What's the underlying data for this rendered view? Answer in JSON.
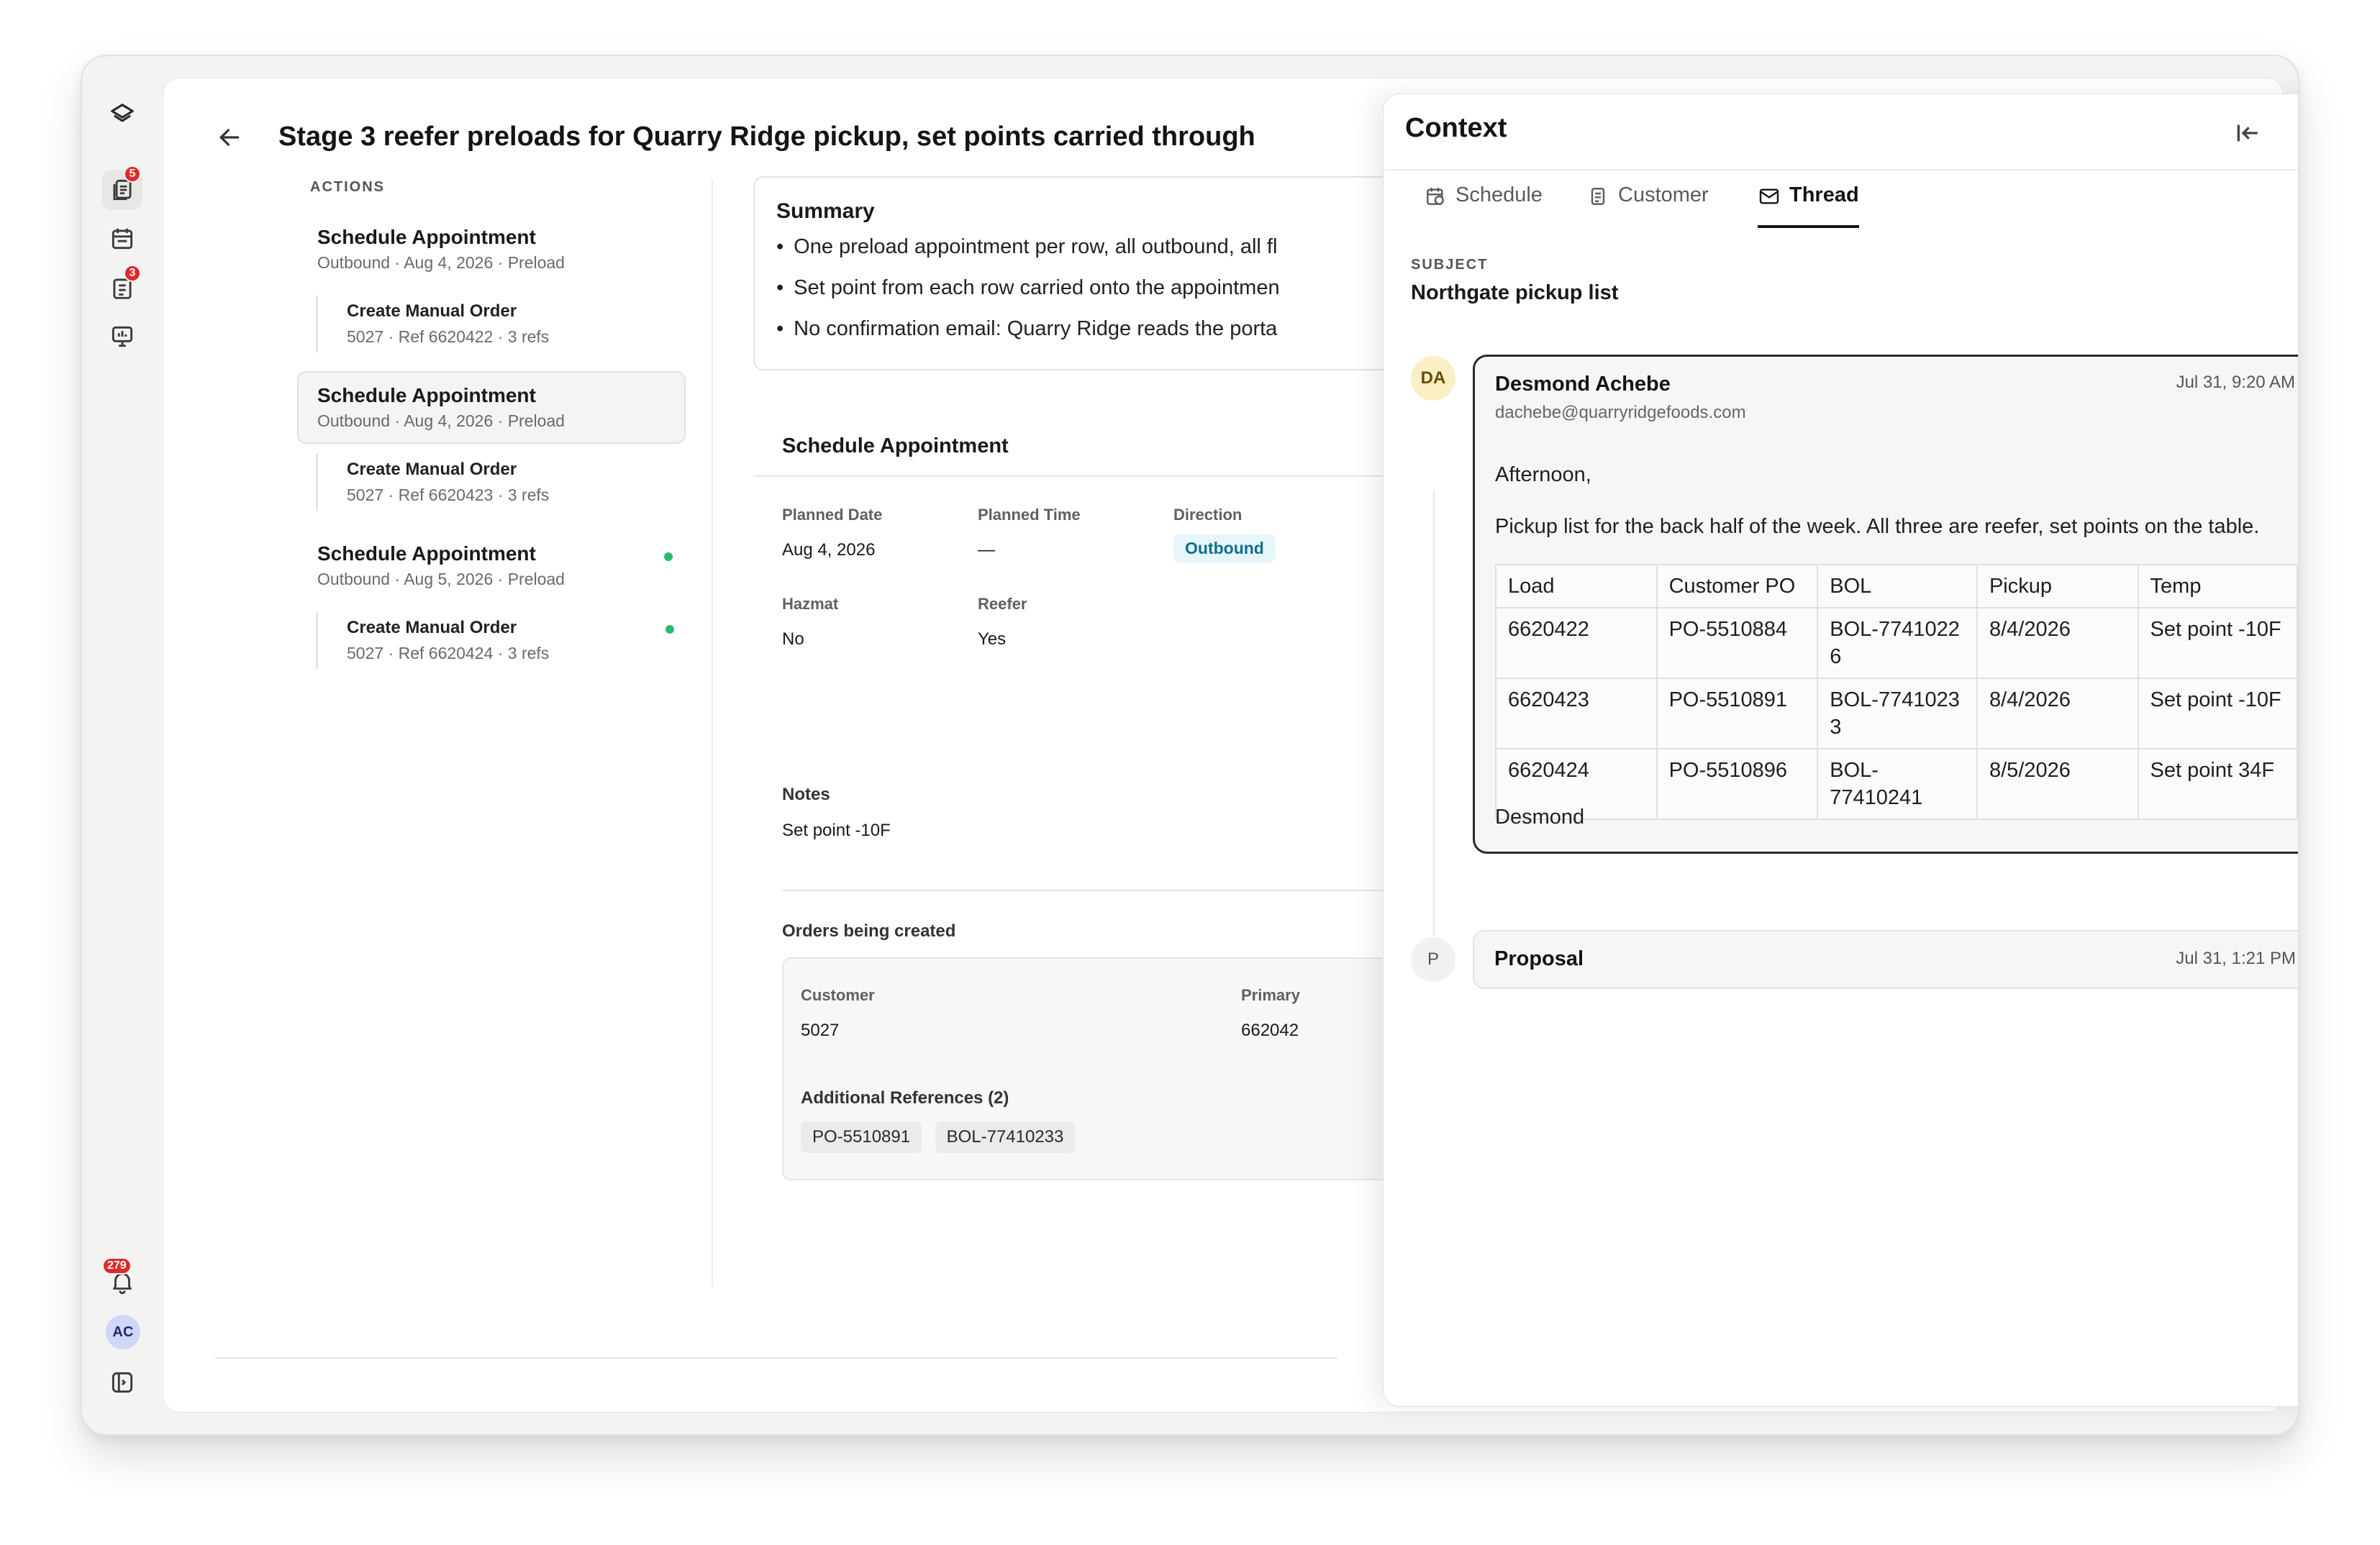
{
  "page": {
    "title": "Stage 3 reefer preloads for Quarry Ridge pickup, set points carried through"
  },
  "rail": {
    "badges": {
      "inbox": "5",
      "orders": "3",
      "notifications": "279"
    },
    "user_initials": "AC"
  },
  "actions": {
    "heading": "ACTIONS",
    "items": [
      {
        "title": "Schedule Appointment",
        "subtitle": "Outbound · Aug 4, 2026 · Preload",
        "child": {
          "title": "Create Manual Order",
          "subtitle": "5027 · Ref 6620422 · 3 refs"
        }
      },
      {
        "title": "Schedule Appointment",
        "subtitle": "Outbound · Aug 4, 2026 · Preload",
        "child": {
          "title": "Create Manual Order",
          "subtitle": "5027 · Ref 6620423 · 3 refs"
        }
      },
      {
        "title": "Schedule Appointment",
        "subtitle": "Outbound · Aug 5, 2026 · Preload",
        "child": {
          "title": "Create Manual Order",
          "subtitle": "5027 · Ref 6620424 · 3 refs"
        }
      }
    ]
  },
  "summary": {
    "title": "Summary",
    "bullets": [
      "One preload appointment per row, all outbound, all fl",
      "Set point from each row carried onto the appointmen",
      "No confirmation email: Quarry Ridge reads the porta"
    ]
  },
  "detail": {
    "heading": "Schedule Appointment",
    "fields": {
      "planned_date": {
        "label": "Planned Date",
        "value": "Aug 4, 2026"
      },
      "planned_time": {
        "label": "Planned Time",
        "value": "—"
      },
      "direction": {
        "label": "Direction",
        "value": "Outbound"
      },
      "hazmat": {
        "label": "Hazmat",
        "value": "No"
      },
      "reefer": {
        "label": "Reefer",
        "value": "Yes"
      },
      "notes": {
        "label": "Notes",
        "value": "Set point -10F"
      }
    },
    "orders": {
      "label": "Orders being created",
      "customer_label": "Customer",
      "customer_value": "5027",
      "primary_label": "Primary",
      "primary_value": "662042",
      "additional_label": "Additional References (2)",
      "refs": [
        "PO-5510891",
        "BOL-77410233"
      ]
    }
  },
  "context": {
    "title": "Context",
    "tabs": [
      "Schedule",
      "Customer",
      "Thread"
    ],
    "active_tab": "Thread",
    "subject_label": "SUBJECT",
    "subject": "Northgate pickup list",
    "message": {
      "initials": "DA",
      "from": "Desmond Achebe",
      "email": "dachebe@quarryridgefoods.com",
      "date": "Jul 31, 9:20 AM",
      "greeting": "Afternoon,",
      "body": "Pickup list for the back half of the week. All three are reefer, set points on the table.",
      "signature": "Desmond",
      "table": {
        "headers": [
          "Load",
          "Customer PO",
          "BOL",
          "Pickup",
          "Temp"
        ],
        "rows": [
          [
            "6620422",
            "PO-5510884",
            "BOL-7741022\n6",
            "8/4/2026",
            "Set point -10F"
          ],
          [
            "6620423",
            "PO-5510891",
            "BOL-7741023\n3",
            "8/4/2026",
            "Set point -10F"
          ],
          [
            "6620424",
            "PO-5510896",
            "BOL-77410241",
            "8/5/2026",
            "Set point 34F"
          ]
        ]
      }
    },
    "proposal": {
      "initial": "P",
      "title": "Proposal",
      "date": "Jul 31, 1:21 PM"
    }
  }
}
